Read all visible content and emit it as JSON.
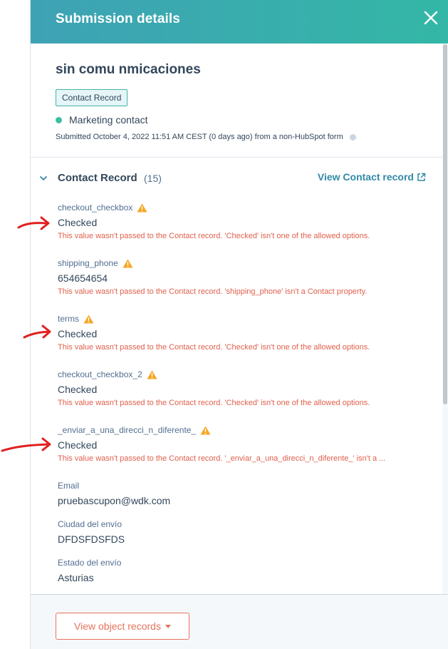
{
  "header": {
    "title": "Submission details",
    "close_icon": "close-icon"
  },
  "contact": {
    "name": "sin comu nmicaciones",
    "record_tag": "Contact Record",
    "lifecycle": "Marketing contact",
    "lifecycle_color": "#3ebfa4",
    "submitted": "Submitted October 4, 2022 11:51 AM CEST (0 days ago) from a non-HubSpot form"
  },
  "section": {
    "title": "Contact Record",
    "count": "(15)",
    "view_link": "View Contact record"
  },
  "fields": [
    {
      "label": "checkout_checkbox",
      "value": "Checked",
      "warning": true,
      "error": "This value wasn't passed to the Contact record. 'Checked' isn't one of the allowed options."
    },
    {
      "label": "shipping_phone",
      "value": "654654654",
      "warning": true,
      "error": "This value wasn't passed to the Contact record. 'shipping_phone' isn't a Contact property."
    },
    {
      "label": "terms",
      "value": "Checked",
      "warning": true,
      "error": "This value wasn't passed to the Contact record. 'Checked' isn't one of the allowed options."
    },
    {
      "label": "checkout_checkbox_2",
      "value": "Checked",
      "warning": true,
      "error": "This value wasn't passed to the Contact record. 'Checked' isn't one of the allowed options."
    },
    {
      "label": "_enviar_a_una_direcci_n_diferente_",
      "value": "Checked",
      "warning": true,
      "error": "This value wasn't passed to the Contact record. '_enviar_a_una_direcci_n_diferente_' isn't a ..."
    },
    {
      "label": "Email",
      "value": "pruebascupon@wdk.com",
      "warning": false,
      "error": ""
    },
    {
      "label": "Ciudad del envío",
      "value": "DFDSFDSFDS",
      "warning": false,
      "error": ""
    },
    {
      "label": "Estado del envío",
      "value": "Asturias",
      "warning": false,
      "error": ""
    }
  ],
  "footer": {
    "button_label": "View object records"
  },
  "colors": {
    "header_gradient_start": "#3ea2b5",
    "header_gradient_end": "#34b7a6",
    "error_text": "#e0604c",
    "warning_icon": "#f5a623",
    "link": "#3189a8",
    "annotation_arrow": "#e02020"
  }
}
